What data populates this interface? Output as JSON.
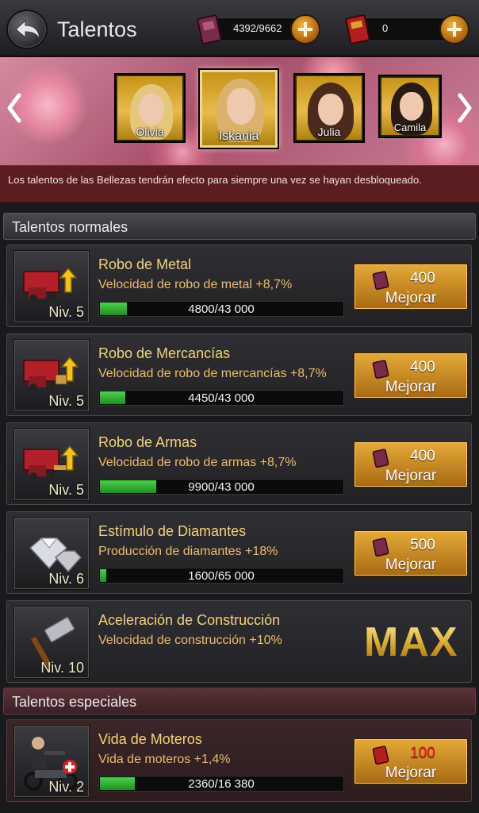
{
  "header": {
    "title": "Talentos",
    "resources": [
      {
        "value": "4392/9662",
        "icon": "talent-book-icon"
      },
      {
        "value": "0",
        "icon": "red-book-icon"
      }
    ]
  },
  "beauties": [
    {
      "name": "Olivia"
    },
    {
      "name": "Iskania",
      "selected": true
    },
    {
      "name": "Julia"
    },
    {
      "name": "Camila"
    }
  ],
  "info_text": "Los talentos de las Bellezas tendrán efecto para siempre una vez se hayan desbloqueado.",
  "normal_section": {
    "title": "Talentos normales",
    "talents": [
      {
        "name": "Robo de Metal",
        "desc": "Velocidad de robo de metal +8,7%",
        "level": "Niv. 5",
        "progress": "4800/43 000",
        "fraction": 0.112,
        "cost": "400",
        "button": "Mejorar"
      },
      {
        "name": "Robo de Mercancías",
        "desc": "Velocidad de robo de mercancías +8,7%",
        "level": "Niv. 5",
        "progress": "4450/43 000",
        "fraction": 0.104,
        "cost": "400",
        "button": "Mejorar"
      },
      {
        "name": "Robo de Armas",
        "desc": "Velocidad de robo de armas +8,7%",
        "level": "Niv. 5",
        "progress": "9900/43 000",
        "fraction": 0.23,
        "cost": "400",
        "button": "Mejorar"
      },
      {
        "name": "Estímulo de Diamantes",
        "desc": "Producción de diamantes +18%",
        "level": "Niv. 6",
        "progress": "1600/65 000",
        "fraction": 0.025,
        "cost": "500",
        "button": "Mejorar"
      },
      {
        "name": "Aceleración de Construcción",
        "desc": "Velocidad de construcción +10%",
        "level": "Niv. 10",
        "max": "MAX"
      }
    ]
  },
  "special_section": {
    "title": "Talentos especiales",
    "talents": [
      {
        "name": "Vida de Moteros",
        "desc": "Vida de moteros +1,4%",
        "level": "Niv. 2",
        "progress": "2360/16 380",
        "fraction": 0.144,
        "cost": "100",
        "cost_color": "#e51d1d",
        "button": "Mejorar"
      }
    ]
  }
}
